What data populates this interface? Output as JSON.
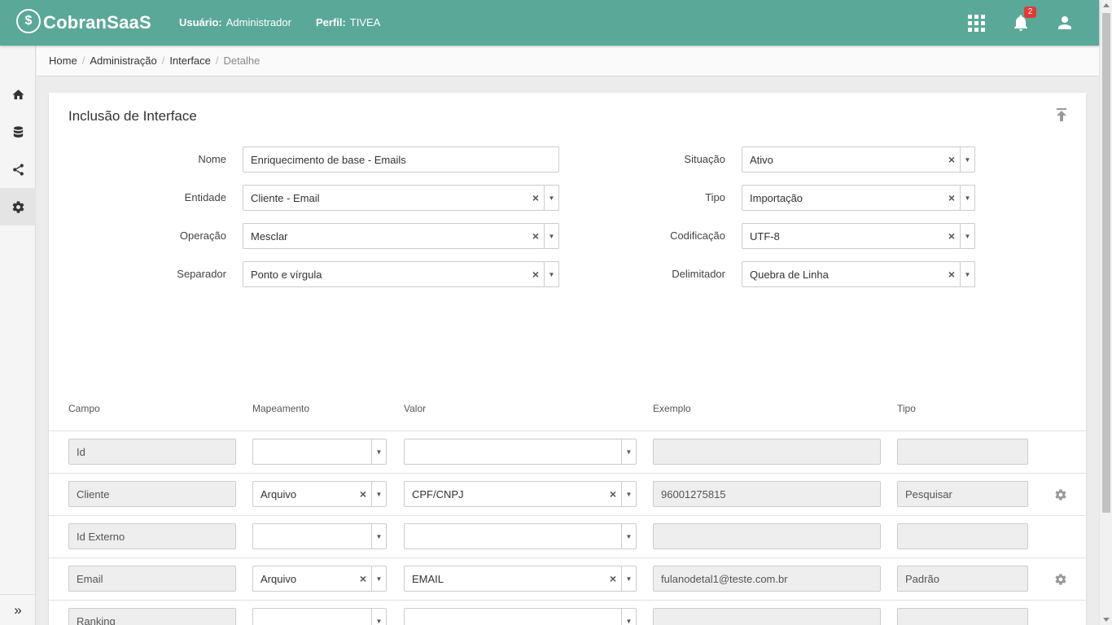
{
  "header": {
    "logo_mark": "$",
    "logo_text": "CobranSaaS",
    "user_label": "Usuário:",
    "user_value": "Administrador",
    "profile_label": "Perfil:",
    "profile_value": "TIVEA",
    "notification_count": "2",
    "icons": [
      "apps-grid-icon",
      "bell-icon",
      "user-icon"
    ]
  },
  "sidebar": {
    "items": [
      "home-icon",
      "database-icon",
      "share-icon",
      "gear-icon"
    ],
    "active": "gear-icon",
    "expand_label": "»"
  },
  "breadcrumb": {
    "items": [
      "Home",
      "Administração",
      "Interface"
    ],
    "current": "Detalhe"
  },
  "card": {
    "title": "Inclusão de Interface",
    "form": {
      "nome": {
        "label": "Nome",
        "value": "Enriquecimento de base - Emails"
      },
      "entidade": {
        "label": "Entidade",
        "value": "Cliente - Email"
      },
      "operacao": {
        "label": "Operação",
        "value": "Mesclar"
      },
      "separador": {
        "label": "Separador",
        "value": "Ponto e vírgula"
      },
      "situacao": {
        "label": "Situação",
        "value": "Ativo"
      },
      "tipo": {
        "label": "Tipo",
        "value": "Importação"
      },
      "codificacao": {
        "label": "Codificação",
        "value": "UTF-8"
      },
      "delimitador": {
        "label": "Delimitador",
        "value": "Quebra de Linha"
      }
    },
    "table": {
      "headers": [
        "Campo",
        "Mapeamento",
        "Valor",
        "Exemplo",
        "Tipo"
      ],
      "rows": [
        {
          "campo": "Id",
          "mapeamento": "",
          "valor": "",
          "exemplo": "",
          "tipo": ""
        },
        {
          "campo": "Cliente",
          "mapeamento": "Arquivo",
          "valor": "CPF/CNPJ",
          "exemplo": "96001275815",
          "tipo": "Pesquisar"
        },
        {
          "campo": "Id Externo",
          "mapeamento": "",
          "valor": "",
          "exemplo": "",
          "tipo": ""
        },
        {
          "campo": "Email",
          "mapeamento": "Arquivo",
          "valor": "EMAIL",
          "exemplo": "fulanodetal1@teste.com.br",
          "tipo": "Padrão"
        },
        {
          "campo": "Ranking",
          "mapeamento": "",
          "valor": "",
          "exemplo": "",
          "tipo": ""
        }
      ]
    }
  },
  "colors": {
    "header_bg": "#5aa898",
    "badge": "#e53935"
  }
}
